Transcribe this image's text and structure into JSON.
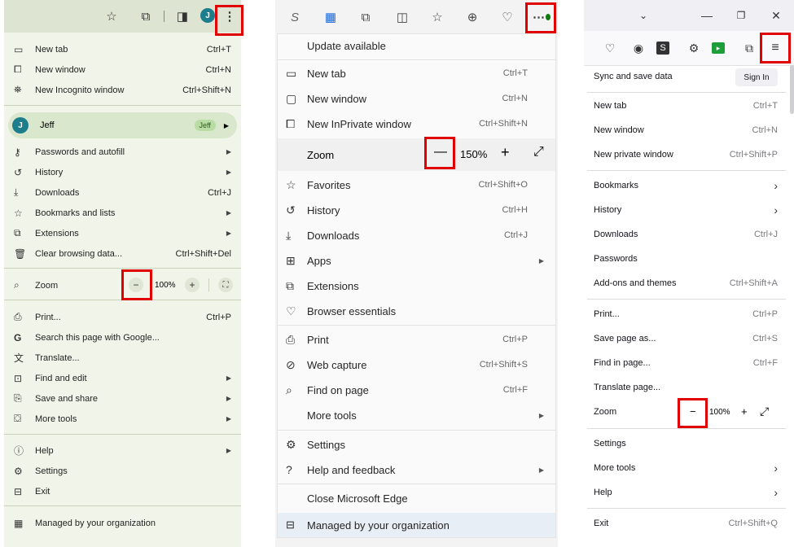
{
  "chrome": {
    "avatar_letter": "J",
    "items": {
      "new_tab": {
        "label": "New tab",
        "shortcut": "Ctrl+T"
      },
      "new_window": {
        "label": "New window",
        "shortcut": "Ctrl+N"
      },
      "incognito": {
        "label": "New Incognito window",
        "shortcut": "Ctrl+Shift+N"
      },
      "passwords": {
        "label": "Passwords and autofill"
      },
      "history": {
        "label": "History"
      },
      "downloads": {
        "label": "Downloads",
        "shortcut": "Ctrl+J"
      },
      "bookmarks": {
        "label": "Bookmarks and lists"
      },
      "extensions": {
        "label": "Extensions"
      },
      "clear": {
        "label": "Clear browsing data...",
        "shortcut": "Ctrl+Shift+Del"
      },
      "print": {
        "label": "Print...",
        "shortcut": "Ctrl+P"
      },
      "search_google": {
        "label": "Search this page with Google..."
      },
      "translate": {
        "label": "Translate..."
      },
      "find_edit": {
        "label": "Find and edit"
      },
      "save_share": {
        "label": "Save and share"
      },
      "more_tools": {
        "label": "More tools"
      },
      "help": {
        "label": "Help"
      },
      "settings": {
        "label": "Settings"
      },
      "exit": {
        "label": "Exit"
      },
      "managed": {
        "label": "Managed by your organization"
      }
    },
    "profile": {
      "name": "Jeff",
      "chip": "Jeff",
      "avatar_letter": "J"
    },
    "zoom": {
      "label": "Zoom",
      "value": "100%",
      "minus": "−",
      "plus": "+"
    }
  },
  "edge": {
    "update": "Update available",
    "items": {
      "new_tab": {
        "label": "New tab",
        "shortcut": "Ctrl+T"
      },
      "new_window": {
        "label": "New window",
        "shortcut": "Ctrl+N"
      },
      "inprivate": {
        "label": "New InPrivate window",
        "shortcut": "Ctrl+Shift+N"
      },
      "favorites": {
        "label": "Favorites",
        "shortcut": "Ctrl+Shift+O"
      },
      "history": {
        "label": "History",
        "shortcut": "Ctrl+H"
      },
      "downloads": {
        "label": "Downloads",
        "shortcut": "Ctrl+J"
      },
      "apps": {
        "label": "Apps"
      },
      "extensions": {
        "label": "Extensions"
      },
      "essentials": {
        "label": "Browser essentials"
      },
      "print": {
        "label": "Print",
        "shortcut": "Ctrl+P"
      },
      "web_capture": {
        "label": "Web capture",
        "shortcut": "Ctrl+Shift+S"
      },
      "find": {
        "label": "Find on page",
        "shortcut": "Ctrl+F"
      },
      "more_tools": {
        "label": "More tools"
      },
      "settings": {
        "label": "Settings"
      },
      "help": {
        "label": "Help and feedback"
      },
      "close": {
        "label": "Close Microsoft Edge"
      },
      "managed": {
        "label": "Managed by your organization"
      }
    },
    "zoom": {
      "label": "Zoom",
      "value": "150%",
      "minus": "—",
      "plus": "+"
    }
  },
  "firefox": {
    "sync": "Sync and save data",
    "signin": "Sign In",
    "items": {
      "new_tab": {
        "label": "New tab",
        "shortcut": "Ctrl+T"
      },
      "new_window": {
        "label": "New window",
        "shortcut": "Ctrl+N"
      },
      "private": {
        "label": "New private window",
        "shortcut": "Ctrl+Shift+P"
      },
      "bookmarks": {
        "label": "Bookmarks"
      },
      "history": {
        "label": "History"
      },
      "downloads": {
        "label": "Downloads",
        "shortcut": "Ctrl+J"
      },
      "passwords": {
        "label": "Passwords"
      },
      "addons": {
        "label": "Add-ons and themes",
        "shortcut": "Ctrl+Shift+A"
      },
      "print": {
        "label": "Print...",
        "shortcut": "Ctrl+P"
      },
      "save": {
        "label": "Save page as...",
        "shortcut": "Ctrl+S"
      },
      "find": {
        "label": "Find in page...",
        "shortcut": "Ctrl+F"
      },
      "translate": {
        "label": "Translate page..."
      },
      "settings": {
        "label": "Settings"
      },
      "more_tools": {
        "label": "More tools"
      },
      "help": {
        "label": "Help"
      },
      "exit": {
        "label": "Exit",
        "shortcut": "Ctrl+Shift+Q"
      }
    },
    "zoom": {
      "label": "Zoom",
      "value": "100%",
      "minus": "−",
      "plus": "+"
    }
  },
  "colors": {
    "highlight": "#e00000",
    "chrome_bg": "#f1f5e9",
    "edge_bg": "#fafafa",
    "firefox_bg": "#ffffff"
  }
}
